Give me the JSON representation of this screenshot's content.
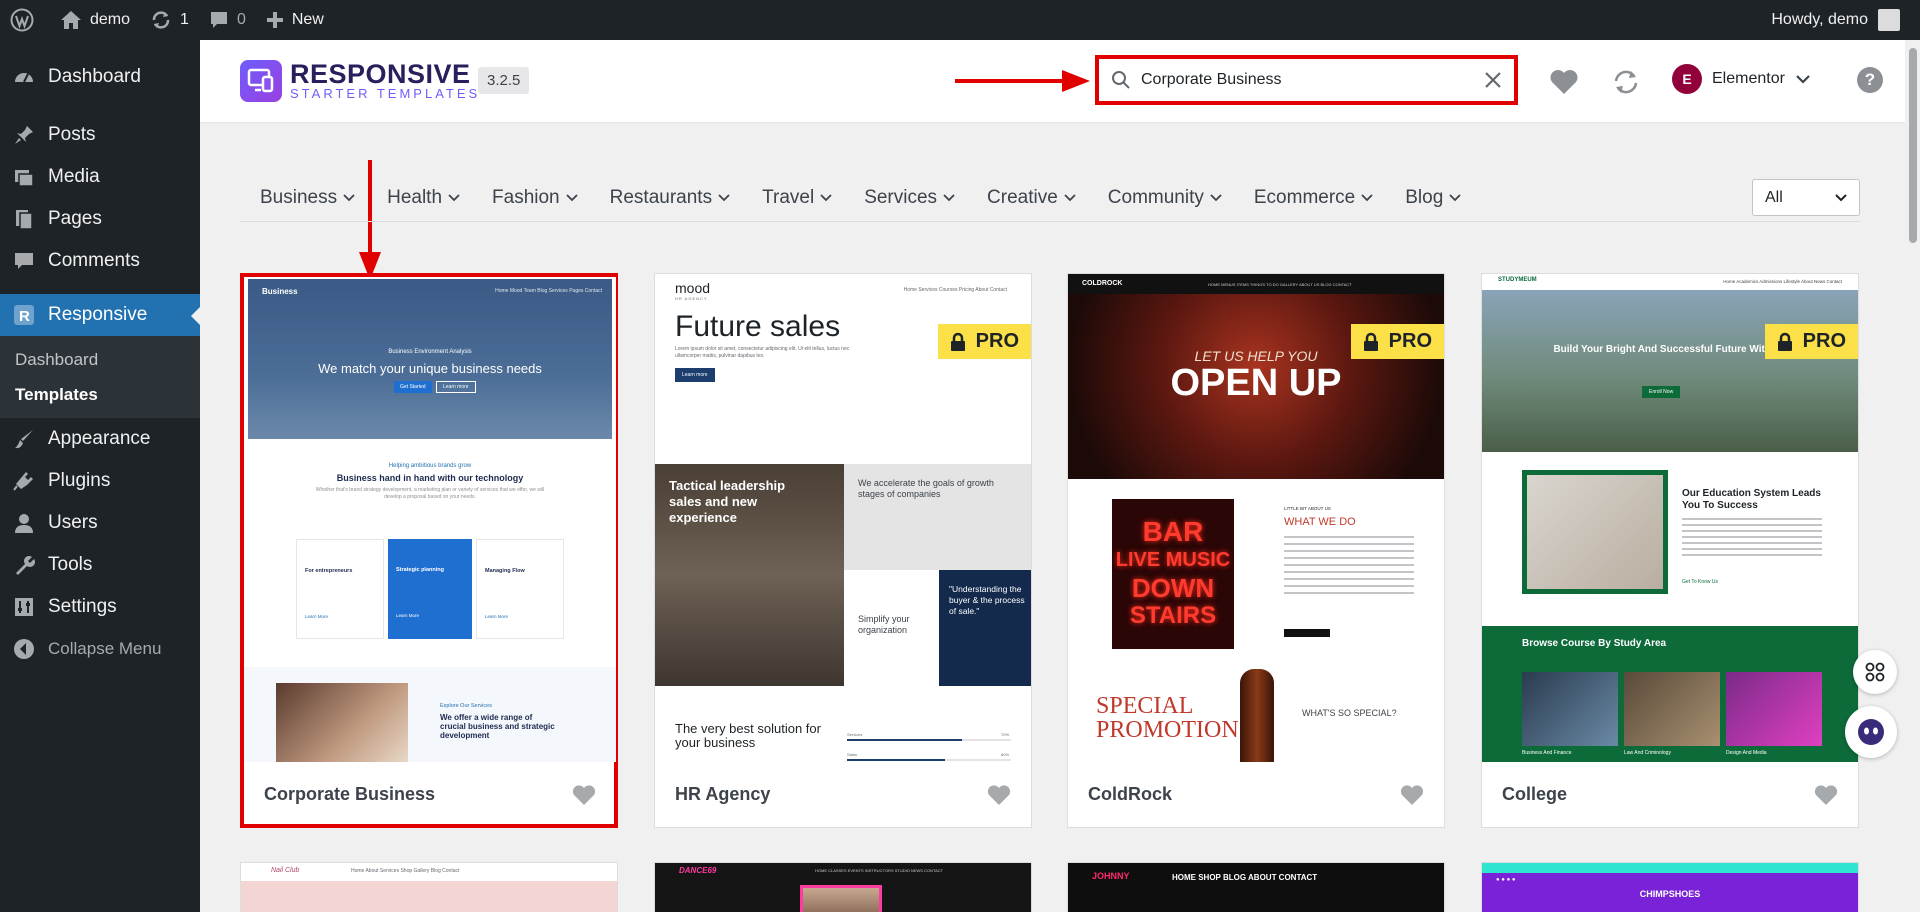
{
  "adminbar": {
    "site_name": "demo",
    "updates_count": "1",
    "comments_count": "0",
    "new_label": "New",
    "howdy": "Howdy, demo"
  },
  "sidebar": {
    "items": [
      {
        "label": "Dashboard",
        "icon": "dashboard-icon"
      },
      {
        "label": "Posts",
        "icon": "pin-icon"
      },
      {
        "label": "Media",
        "icon": "media-icon"
      },
      {
        "label": "Pages",
        "icon": "pages-icon"
      },
      {
        "label": "Comments",
        "icon": "comment-icon"
      },
      {
        "label": "Responsive",
        "icon": "responsive-icon"
      },
      {
        "label": "Appearance",
        "icon": "brush-icon"
      },
      {
        "label": "Plugins",
        "icon": "plugin-icon"
      },
      {
        "label": "Users",
        "icon": "user-icon"
      },
      {
        "label": "Tools",
        "icon": "wrench-icon"
      },
      {
        "label": "Settings",
        "icon": "settings-icon"
      }
    ],
    "submenu": [
      "Dashboard",
      "Templates"
    ],
    "collapse": "Collapse Menu"
  },
  "header": {
    "logo_line1": "RESPONSIVE",
    "logo_line2": "STARTER TEMPLATES",
    "version": "3.2.5",
    "search_value": "Corporate Business",
    "builder": "Elementor",
    "builder_badge": "E",
    "help": "?"
  },
  "categories": [
    "Business",
    "Health",
    "Fashion",
    "Restaurants",
    "Travel",
    "Services",
    "Creative",
    "Community",
    "Ecommerce",
    "Blog"
  ],
  "filter": {
    "selected": "All"
  },
  "cards": [
    {
      "name": "Corporate Business",
      "pro": false,
      "thumb": {
        "nav_brand": "Business",
        "nav_links": "Home  Mood  Team  Blog  Services  Pages  Contact",
        "hero_small": "Business Environment Analysis",
        "hero_title": "We match your unique business needs",
        "hero_btn1": "Get Started",
        "hero_btn2": "Learn more",
        "sec_small": "Helping ambitious brands grow",
        "sec_title": "Business hand in hand with our technology",
        "sec_desc": "Whether that's brand strategy development, a marketing plan or variety of services that we offer, we will develop a proposal based on your needs.",
        "feature1": "For entrepreneurs",
        "feature2": "Strategic planning",
        "feature3": "Managing Flow",
        "learn_more": "Learn More",
        "explore_small": "Explore Our Services",
        "explore_title": "We offer a wide range of crucial business and strategic development"
      }
    },
    {
      "name": "HR Agency",
      "pro": true,
      "pro_label": "PRO",
      "thumb": {
        "brand": "mood",
        "brand_sub": "HR AGENCY",
        "nav_links": "Home  Services  Courses  Pricing  About  Contact",
        "hero_title": "Future sales",
        "hero_desc": "Lorem ipsum dolor sit amet, consectetur adipiscing elit. Ut elit tellus, luctus nec ullamcorper mattis, pulvinar dapibus leo.",
        "hero_btn": "Learn more",
        "block1": "Tactical leadership sales and new experience",
        "block2": "We accelerate the goals of growth stages of companies",
        "block3": "Simplify your organization",
        "block4": "\"Understanding the buyer & the process of sale.\"",
        "bottom_title": "The very best solution for your business",
        "bar1": "Services",
        "bar1_val": "70%",
        "bar2": "Sales",
        "bar2_val": "60%"
      }
    },
    {
      "name": "ColdRock",
      "pro": true,
      "pro_label": "PRO",
      "thumb": {
        "brand": "COLDROCK",
        "nav_links": "HOME  MENUS ITEMS  THINGS TO DO  GALLERY  ABOUT US  BLOG  CONTACT",
        "hero_small": "LET US HELP YOU",
        "hero_title": "OPEN UP",
        "neon1": "BAR",
        "neon2": "LIVE MUSIC",
        "neon3": "DOWN",
        "neon4": "STAIRS",
        "what_small": "LITTLE BIT ABOUT US",
        "what_title": "WHAT WE DO",
        "special": "SPECIAL PROMOTION",
        "whats_special": "WHAT'S SO SPECIAL?"
      }
    },
    {
      "name": "College",
      "pro": true,
      "pro_label": "PRO",
      "thumb": {
        "brand": "STUDYMEUM",
        "nav_links": "Home  Academics  Admissions  Lifestyle  About  News  Contact",
        "hero_title": "Build Your Bright And Successful Future With Us",
        "hero_btn": "Enroll Now",
        "edu_title": "Our Education System Leads You To Success",
        "edu_link": "Get To Know Us",
        "browse_title": "Browse Course By Study Area",
        "course1": "Business And Finance",
        "course2": "Law And Criminology",
        "course3": "Design And Media"
      }
    }
  ],
  "row2": [
    {
      "brand": "Nail Club",
      "nav": "Home  About  Services  Shop  Gallery  Blog  Contact"
    },
    {
      "brand": "DANCE69",
      "nav": "HOME  CLASSES  EVENTS  INSTRUCTORS  STUDIO  NEWS  CONTACT"
    },
    {
      "brand": "JOHNNY",
      "nav": "HOME  SHOP  BLOG  ABOUT  CONTACT"
    },
    {
      "brand": "CHIMPSHOES",
      "nav": ""
    }
  ],
  "colors": {
    "accent": "#2271b1",
    "highlight": "#e00000",
    "pro": "#fce047",
    "brand": "#6d5efc"
  }
}
